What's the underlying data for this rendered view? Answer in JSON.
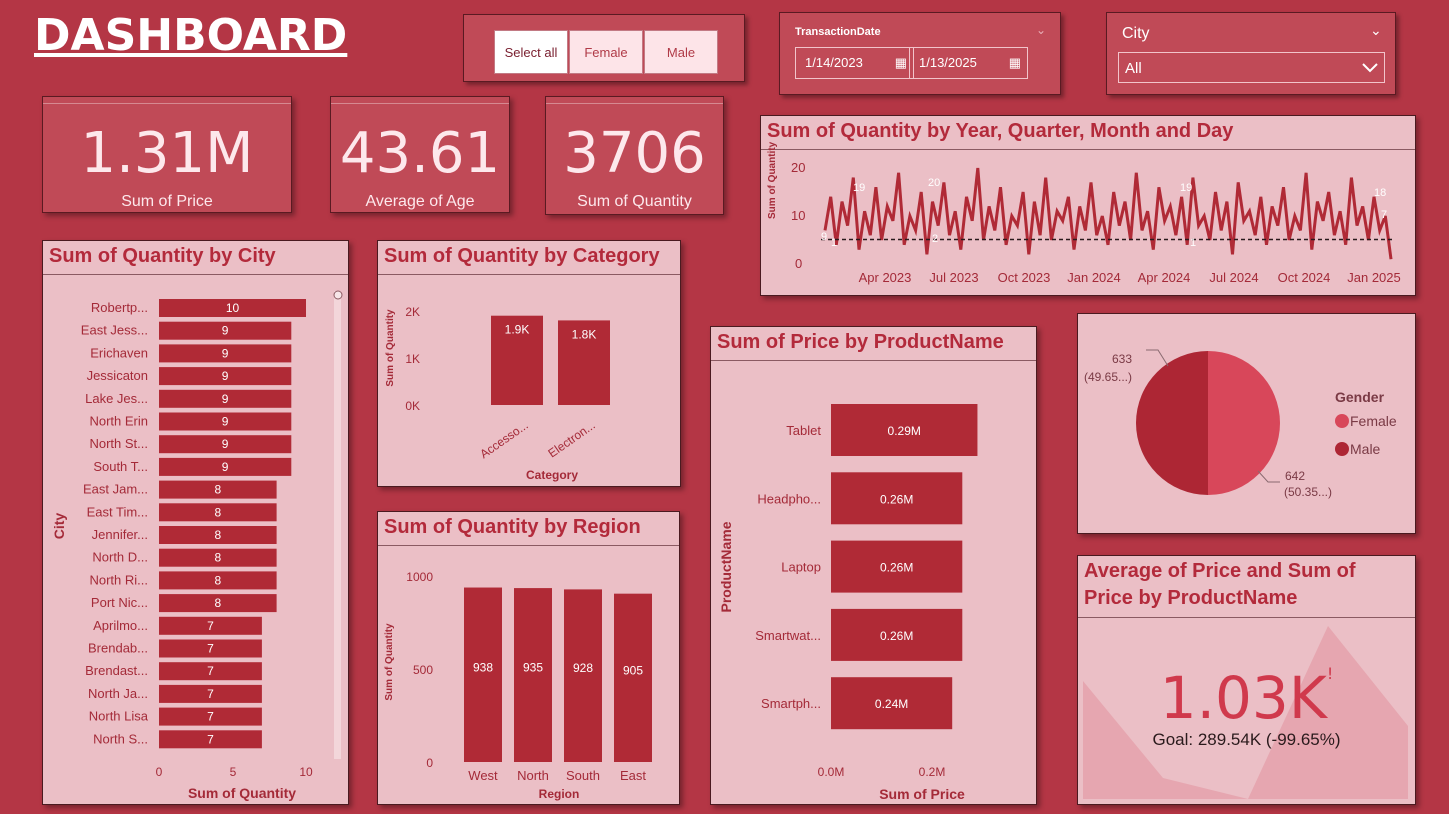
{
  "header": {
    "title": "DASHBOARD"
  },
  "gender_slicer": {
    "options": [
      "Select all",
      "Female",
      "Male"
    ]
  },
  "date_slicer": {
    "label": "TransactionDate",
    "start": "1/14/2023",
    "end": "1/13/2025"
  },
  "city_slicer": {
    "label": "City",
    "value": "All"
  },
  "kpis": [
    {
      "value": "1.31M",
      "label": "Sum of Price"
    },
    {
      "value": "43.61",
      "label": "Average of Age"
    },
    {
      "value": "3706",
      "label": "Sum of Quantity"
    }
  ],
  "colors": {
    "background": "#b43645",
    "bar": "#b02a36",
    "panel": "#ebbfc6",
    "female": "#d8475a",
    "male": "#ad2634"
  },
  "charts": {
    "timeline": {
      "title": "Sum of Quantity by Year, Quarter, Month and Day",
      "ylabel": "Sum of Quantity",
      "yticks": [
        "20",
        "10",
        "0"
      ],
      "xticks": [
        "Apr 2023",
        "Jul 2023",
        "Oct 2023",
        "Jan 2024",
        "Apr 2024",
        "Jul 2024",
        "Oct 2024",
        "Jan 2025"
      ],
      "labels": [
        "9",
        "19",
        "20",
        "2",
        "19",
        "1",
        "18",
        "7",
        "1"
      ]
    },
    "city": {
      "title": "Sum of Quantity by City",
      "ylabel": "City",
      "xlabel": "Sum of Quantity",
      "xticks": [
        "0",
        "5",
        "10"
      ]
    },
    "category": {
      "title": "Sum of Quantity by Category",
      "ylabel": "Sum of Quantity",
      "xlabel": "Category",
      "yticks": [
        "2K",
        "1K",
        "0K"
      ],
      "data_labels": [
        "1.9K",
        "1.8K"
      ]
    },
    "region": {
      "title": "Sum of Quantity by Region",
      "ylabel": "Sum of Quantity",
      "xlabel": "Region",
      "yticks": [
        "1000",
        "500",
        "0"
      ]
    },
    "product": {
      "title": "Sum of Price by ProductName",
      "ylabel": "ProductName",
      "xlabel": "Sum of Price",
      "xticks": [
        "0.0M",
        "0.2M"
      ]
    },
    "pie": {
      "legend_title": "Gender",
      "female_label": [
        "633",
        "(49.65...)"
      ],
      "male_label": [
        "642",
        "(50.35...)"
      ]
    },
    "gauge": {
      "title_line1": "Average of Price and Sum of",
      "title_line2": "Price by ProductName",
      "value": "1.03K",
      "mark": "!",
      "goal": "Goal: 289.54K (-99.65%)"
    }
  },
  "chart_data": [
    {
      "type": "bar",
      "title": "Sum of Quantity by City",
      "xlabel": "Sum of Quantity",
      "ylabel": "City",
      "categories": [
        "Robertp...",
        "East Jess...",
        "Erichaven",
        "Jessicaton",
        "Lake Jes...",
        "North Erin",
        "North St...",
        "South T...",
        "East Jam...",
        "East Tim...",
        "Jennifer...",
        "North D...",
        "North Ri...",
        "Port Nic...",
        "Aprilmo...",
        "Brendab...",
        "Brendast...",
        "North Ja...",
        "North Lisa",
        "North S..."
      ],
      "values": [
        10,
        9,
        9,
        9,
        9,
        9,
        9,
        9,
        8,
        8,
        8,
        8,
        8,
        8,
        7,
        7,
        7,
        7,
        7,
        7
      ],
      "xlim": [
        0,
        10
      ]
    },
    {
      "type": "bar",
      "title": "Sum of Quantity by Category",
      "xlabel": "Category",
      "ylabel": "Sum of Quantity",
      "categories": [
        "Accesso...",
        "Electron..."
      ],
      "values": [
        1900,
        1800
      ],
      "ylim": [
        0,
        2000
      ]
    },
    {
      "type": "bar",
      "title": "Sum of Quantity by Region",
      "xlabel": "Region",
      "ylabel": "Sum of Quantity",
      "categories": [
        "West",
        "North",
        "South",
        "East"
      ],
      "values": [
        938,
        935,
        928,
        905
      ],
      "ylim": [
        0,
        1000
      ]
    },
    {
      "type": "bar",
      "title": "Sum of Price by ProductName",
      "xlabel": "Sum of Price",
      "ylabel": "ProductName",
      "categories": [
        "Tablet",
        "Headpho...",
        "Laptop",
        "Smartwat...",
        "Smartph..."
      ],
      "values": [
        0.29,
        0.26,
        0.26,
        0.26,
        0.24
      ],
      "data_labels": [
        "0.29M",
        "0.26M",
        "0.26M",
        "0.26M",
        "0.24M"
      ]
    },
    {
      "type": "pie",
      "legend_title": "Gender",
      "categories": [
        "Female",
        "Male"
      ],
      "values": [
        633,
        642
      ]
    },
    {
      "type": "line",
      "title": "Sum of Quantity by Year, Quarter, Month and Day",
      "ylabel": "Sum of Quantity",
      "ylim": [
        0,
        20
      ],
      "x_range": [
        "1/14/2023",
        "1/13/2025"
      ],
      "average_line": 5.1,
      "values": [
        7,
        14,
        4,
        13,
        8,
        18,
        3,
        11,
        6,
        16,
        5,
        12,
        9,
        19,
        4,
        10,
        7,
        15,
        2,
        13,
        8,
        17,
        6,
        11,
        3,
        14,
        9,
        20,
        5,
        12,
        7,
        16,
        4,
        10,
        8,
        15,
        2,
        13,
        6,
        18,
        5,
        11,
        9,
        14,
        3,
        12,
        7,
        17,
        6,
        10,
        4,
        15,
        8,
        13,
        5,
        19,
        7,
        11,
        3,
        16,
        9,
        12,
        6,
        14,
        4,
        18,
        8,
        10,
        5,
        15,
        7,
        13,
        2,
        17,
        9,
        11,
        6,
        14,
        4,
        12,
        8,
        16,
        5,
        10,
        7,
        19,
        3,
        13,
        9,
        15,
        6,
        11,
        4,
        18,
        8,
        12,
        5,
        14,
        7,
        10,
        1
      ]
    }
  ]
}
